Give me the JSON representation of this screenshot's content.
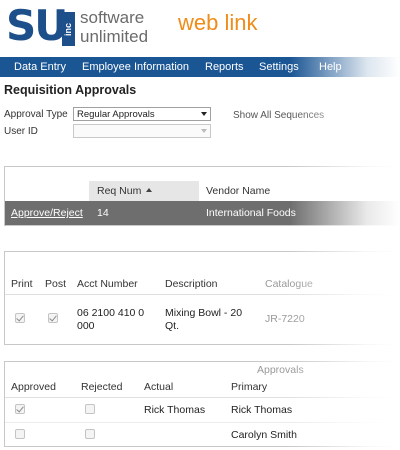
{
  "logo": {
    "mark": "SU",
    "mark_inc": "inc",
    "line1": "software",
    "line2": "unlimited",
    "product": "web link"
  },
  "nav": [
    "Data Entry",
    "Employee Information",
    "Reports",
    "Settings",
    "Help"
  ],
  "title": "Requisition Approvals",
  "filters": {
    "approval_type_label": "Approval Type",
    "approval_type_value": "Regular Approvals",
    "user_id_label": "User ID",
    "user_id_value": "",
    "show_all_label": "Show All Sequences"
  },
  "requisitions": {
    "columns": {
      "req_num": "Req Num",
      "vendor": "Vendor Name"
    },
    "row": {
      "action": "Approve/Reject",
      "req_num": "14",
      "vendor": "International Foods"
    }
  },
  "lines": {
    "columns": {
      "print": "Print",
      "post": "Post",
      "acct": "Acct Number",
      "description": "Description",
      "catalogue": "Catalogue"
    },
    "row": {
      "print": true,
      "post": true,
      "acct_line1": "06 2100 410 0",
      "acct_line2": "000",
      "desc_line1": "Mixing Bowl - 20",
      "desc_line2": "Qt.",
      "catalogue": "JR-7220"
    }
  },
  "approvals": {
    "group_label": "Approvals",
    "columns": {
      "approved": "Approved",
      "rejected": "Rejected",
      "actual": "Actual",
      "primary": "Primary"
    },
    "rows": [
      {
        "approved": true,
        "rejected": false,
        "actual": "Rick Thomas",
        "primary": "Rick Thomas"
      },
      {
        "approved": false,
        "rejected": false,
        "actual": "",
        "primary": "Carolyn Smith"
      }
    ]
  },
  "colors": {
    "brand": "#1b5694",
    "accent": "#f08c1a",
    "selected_row": "#6e6e6e"
  }
}
